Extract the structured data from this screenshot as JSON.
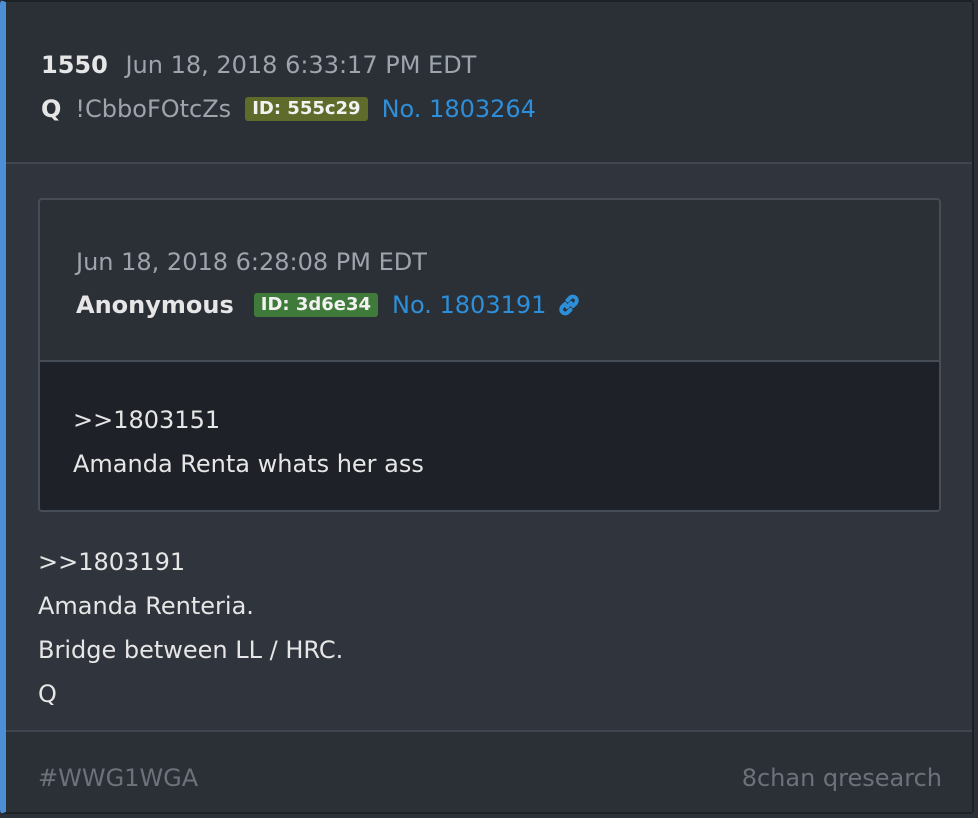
{
  "post": {
    "number": "1550",
    "date": "Jun 18, 2018 6:33:17 PM EDT",
    "author": "Q",
    "tripcode": "!CbboFOtcZs",
    "id_label": "ID: 555c29",
    "post_link": "No. 1803264",
    "body": [
      ">>1803191",
      "Amanda Renteria.",
      "Bridge between LL / HRC.",
      "Q"
    ]
  },
  "quoted": {
    "date": "Jun 18, 2018 6:28:08 PM EDT",
    "author": "Anonymous",
    "id_label": "ID: 3d6e34",
    "post_link": "No. 1803191",
    "link_icon": "link-icon",
    "body": [
      ">>1803151",
      "Amanda Renta whats her ass"
    ]
  },
  "footer": {
    "tag": "#WWG1WGA",
    "source": "8chan qresearch"
  },
  "colors": {
    "accent_border": "#4d8fd6",
    "link": "#2d8fd9",
    "id_badge_q": "#5e6b2a",
    "id_badge_anon": "#3f7a3a"
  }
}
